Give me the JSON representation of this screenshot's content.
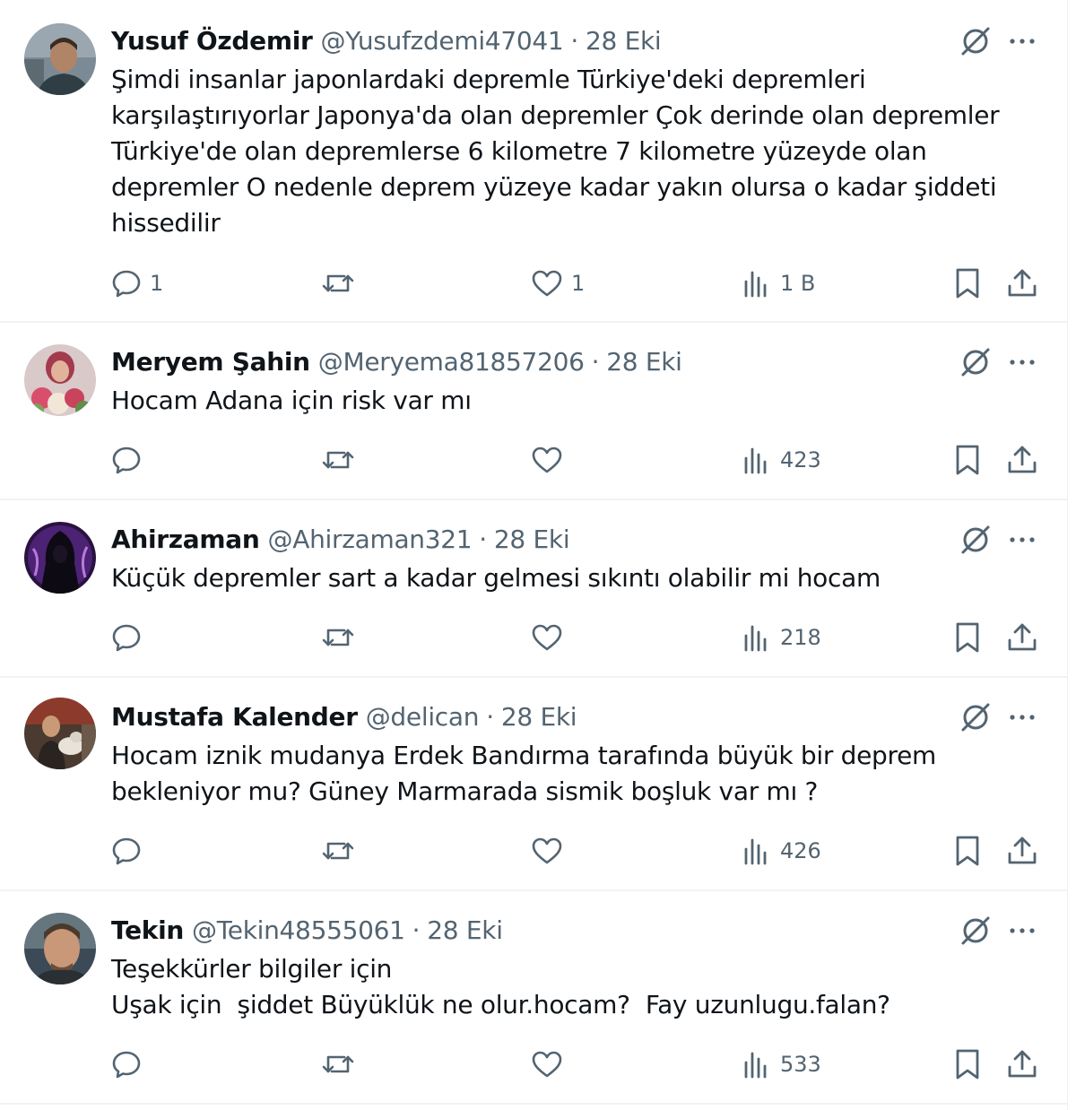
{
  "tweets": [
    {
      "name": "Yusuf Özdemir",
      "handle": "@Yusufzdemi47041",
      "date": "28 Eki",
      "lines": [
        "Şimdi insanlar japonlardaki depremle Türkiye'deki depremleri",
        "karşılaştırıyorlar Japonya'da olan depremler Çok derinde olan depremler",
        "Türkiye'de olan depremlerse 6 kilometre 7 kilometre yüzeyde olan",
        "depremler O nedenle deprem yüzeye kadar yakın olursa o kadar şiddeti",
        "hissedilir"
      ],
      "replies": "1",
      "retweets": "",
      "likes": "1",
      "views": "1 B"
    },
    {
      "name": "Meryem Şahin",
      "handle": "@Meryema81857206",
      "date": "28 Eki",
      "lines": [
        "Hocam Adana için risk var mı"
      ],
      "replies": "",
      "retweets": "",
      "likes": "",
      "views": "423"
    },
    {
      "name": "Ahirzaman",
      "handle": "@Ahirzaman321",
      "date": "28 Eki",
      "lines": [
        "Küçük depremler sart a kadar gelmesi sıkıntı olabilir mi hocam"
      ],
      "replies": "",
      "retweets": "",
      "likes": "",
      "views": "218"
    },
    {
      "name": "Mustafa Kalender",
      "handle": "@delican",
      "date": "28 Eki",
      "lines": [
        "Hocam iznik mudanya Erdek Bandırma tarafında büyük bir deprem",
        "bekleniyor mu? Güney Marmarada sismik boşluk var mı ?"
      ],
      "replies": "",
      "retweets": "",
      "likes": "",
      "views": "426"
    },
    {
      "name": "Tekin",
      "handle": "@Tekin48555061",
      "date": "28 Eki",
      "lines": [
        "Teşekkürler bilgiler için",
        "Uşak için  şiddet Büyüklük ne olur.hocam?  Fay uzunlugu.falan?"
      ],
      "replies": "",
      "retweets": "",
      "likes": "",
      "views": "533"
    }
  ],
  "colors": {
    "text": "#0f1419",
    "secondary": "#536471",
    "border": "#eff3f4"
  },
  "icons": {
    "reply": "speech-bubble-icon",
    "retweet": "retweet-arrows-icon",
    "like": "heart-icon",
    "views": "bar-chart-icon",
    "bookmark": "bookmark-icon",
    "share": "share-upload-icon",
    "grok": "grok-slash-icon",
    "more": "more-dots-icon"
  }
}
